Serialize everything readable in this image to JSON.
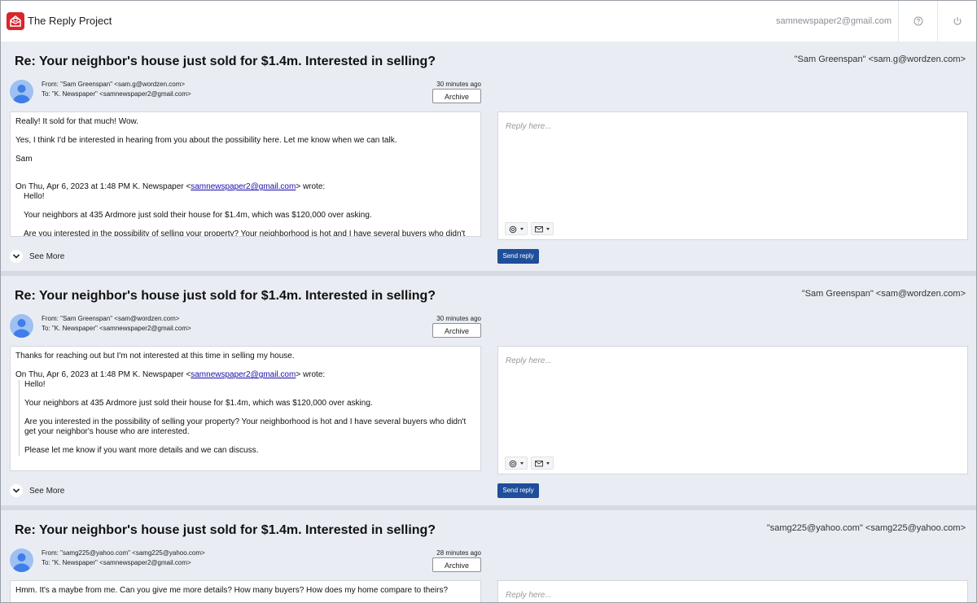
{
  "app": {
    "title": "The Reply Project",
    "account": "samnewspaper2@gmail.com"
  },
  "colors": {
    "brand": "#d8262c",
    "send_button": "#1f4e9a",
    "background": "#e9edf3"
  },
  "icons": [
    "mail-logo-icon",
    "help-icon",
    "power-icon",
    "avatar-icon",
    "chevron-down-icon",
    "openai-icon",
    "envelope-icon"
  ],
  "threads": [
    {
      "subject": "Re: Your neighbor's house just sold for $1.4m. Interested in selling?",
      "sender": "\"Sam Greenspan\" <sam.g@wordzen.com>",
      "from": "From: \"Sam Greenspan\" <sam.g@wordzen.com>",
      "to": "To: \"K. Newspaper\" <samnewspaper2@gmail.com>",
      "time": "30 minutes ago",
      "archive": "Archive",
      "body": [
        "Really! It sold for that much! Wow.",
        "Yes, I think I'd be interested in hearing from you about the possibility here. Let me know when we can talk.",
        "Sam"
      ],
      "quote_header_pre": "On Thu, Apr 6, 2023 at 1:48 PM K. Newspaper <",
      "quote_email": "samnewspaper2@gmail.com",
      "quote_header_post": "> wrote:",
      "quote": [
        "Hello!",
        "Your neighbors at 435 Ardmore just sold their house for $1.4m, which was $120,000 over asking.",
        "Are you interested in the possibility of selling your property? Your neighborhood is hot and I have several buyers who didn't get"
      ],
      "see_more": "See More",
      "reply_placeholder": "Reply here...",
      "send": "Send reply"
    },
    {
      "subject": "Re: Your neighbor's house just sold for $1.4m. Interested in selling?",
      "sender": "\"Sam Greenspan\" <sam@wordzen.com>",
      "from": "From: \"Sam Greenspan\" <sam@wordzen.com>",
      "to": "To: \"K. Newspaper\" <samnewspaper2@gmail.com>",
      "time": "30 minutes ago",
      "archive": "Archive",
      "body": [
        "Thanks for reaching out but I'm not interested at this time in selling my house."
      ],
      "quote_header_pre": "On Thu, Apr 6, 2023 at 1:48 PM K. Newspaper <",
      "quote_email": "samnewspaper2@gmail.com",
      "quote_header_post": "> wrote:",
      "quote": [
        "Hello!",
        "Your neighbors at 435 Ardmore just sold their house for $1.4m, which was $120,000 over asking.",
        "Are you interested in the possibility of selling your property? Your neighborhood is hot and I have several buyers who didn't get your neighbor's house who are interested.",
        "Please let me know if you want more details and we can discuss."
      ],
      "see_more": "See More",
      "reply_placeholder": "Reply here...",
      "send": "Send reply"
    },
    {
      "subject": "Re: Your neighbor's house just sold for $1.4m. Interested in selling?",
      "sender": "\"samg225@yahoo.com\" <samg225@yahoo.com>",
      "from": "From: \"samg225@yahoo.com\" <samg225@yahoo.com>",
      "to": "To: \"K. Newspaper\" <samnewspaper2@gmail.com>",
      "time": "28 minutes ago",
      "archive": "Archive",
      "body": [
        "Hmm. It's a maybe from me. Can you give me more details? How many buyers? How does my home compare to theirs?"
      ],
      "reply_placeholder": "Reply here..."
    }
  ]
}
